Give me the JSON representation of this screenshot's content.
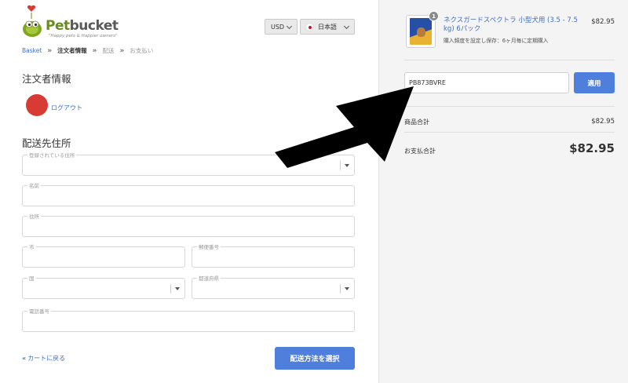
{
  "logo": {
    "brand_a": "Pet",
    "brand_b": "bucket",
    "tagline": "\"Happy pets & Happier owners\""
  },
  "header": {
    "currency": "USD",
    "language": "日本語"
  },
  "breadcrumb": [
    {
      "label": "Basket",
      "state": "link"
    },
    {
      "label": "注文者情報",
      "state": "active"
    },
    {
      "label": "配送",
      "state": "muted"
    },
    {
      "label": "お支払い",
      "state": "muted"
    }
  ],
  "breadcrumb_sep": "»",
  "customer": {
    "heading": "注文者情報",
    "logout": "ログアウト"
  },
  "shipping": {
    "heading": "配送先住所",
    "saved_address": "登録されている住所",
    "name": "名前",
    "address": "住所",
    "city": "市",
    "postal": "郵便番号",
    "country": "国",
    "prefecture": "都道府県",
    "phone": "電話番号"
  },
  "actions": {
    "back": "カートに戻る",
    "back_chevron": "«",
    "continue": "配送方法を選択"
  },
  "cart": {
    "item": {
      "qty": "1",
      "name": "ネクスガードスペクトラ 小型犬用 (3.5 - 7.5 kg) 6パック",
      "subscription": "購入頻度を設定し保存：6ヶ月毎に定期購入",
      "price": "$82.95"
    },
    "discount_code": "PB873BVRE",
    "apply": "適用",
    "subtotal_label": "商品合計",
    "subtotal": "$82.95",
    "total_label": "お支払合計",
    "total": "$82.95"
  },
  "colors": {
    "accent": "#4f7fdd",
    "link": "#3f6fc6",
    "avatar": "#d83a34"
  }
}
